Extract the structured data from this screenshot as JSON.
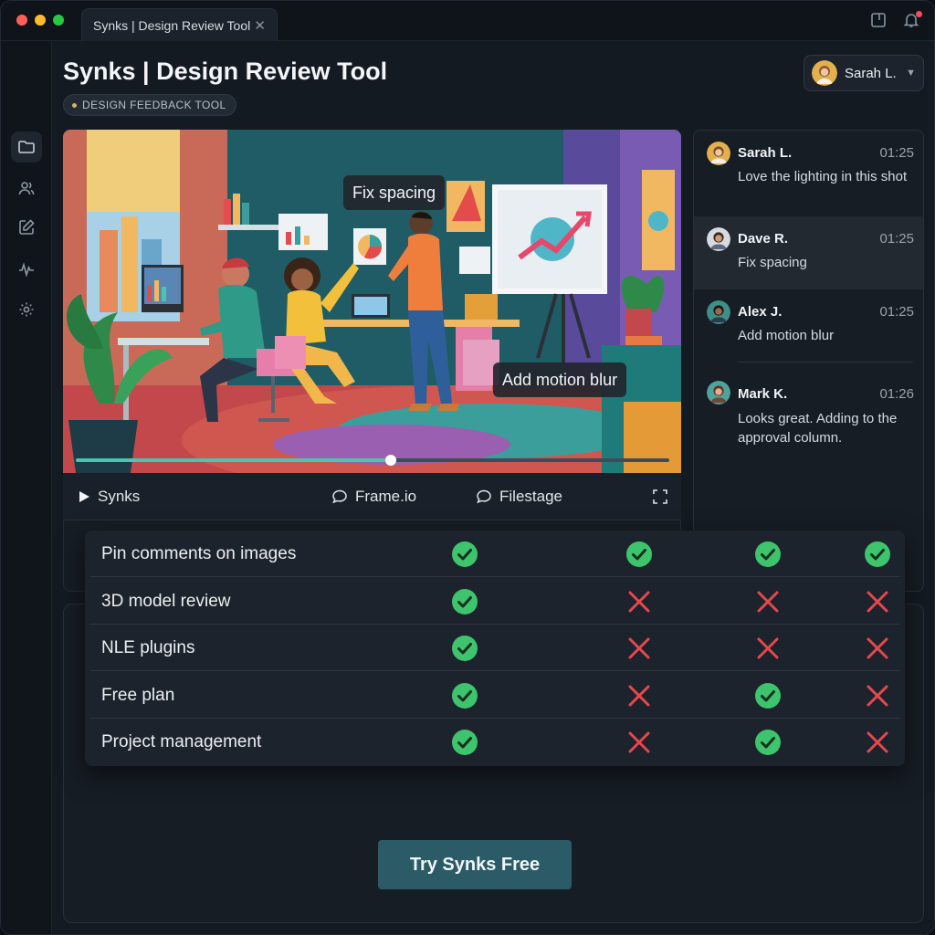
{
  "window": {
    "tab_title": "Synks | Design Review Tool",
    "icons": [
      "close-dot",
      "minimize-dot",
      "maximize-dot",
      "tab-close-icon",
      "bookmark-icon",
      "bell-icon"
    ],
    "traffic_colors": [
      "#ff5f57",
      "#febc2e",
      "#28c840"
    ]
  },
  "sidebar": {
    "items": [
      {
        "name": "folder-icon"
      },
      {
        "name": "users-icon"
      },
      {
        "name": "edit-icon"
      },
      {
        "name": "activity-icon"
      },
      {
        "name": "settings-icon"
      }
    ]
  },
  "header": {
    "title": "Synks | Design Review Tool",
    "badge": "DESIGN FEEDBACK TOOL",
    "user": {
      "name": "Sarah L."
    }
  },
  "video": {
    "annotations": [
      "Fix spacing",
      "Add motion blur"
    ],
    "progress": 0.53,
    "controls": {
      "play_label": "Synks",
      "frameio_label": "Frame.io",
      "filestage_label": "Filestage"
    }
  },
  "comments": [
    {
      "name": "Sarah L.",
      "time": "01:25",
      "text": "Love the lighting in this shot",
      "avatar_color": "#d9a063"
    },
    {
      "name": "Dave R.",
      "time": "01:25",
      "text": "Fix spacing",
      "avatar_color": "#b98b62"
    },
    {
      "name": "Alex J.",
      "time": "01:25",
      "text": "Add motion blur",
      "avatar_color": "#7d5a44"
    },
    {
      "name": "Mark K.",
      "time": "01:26",
      "text": "Looks great. Adding to the approval column.",
      "avatar_color": "#c58a6a"
    }
  ],
  "comparison": {
    "rows": [
      {
        "feature": "Pin comments on images",
        "values": [
          true,
          true,
          true,
          true
        ]
      },
      {
        "feature": "3D model review",
        "values": [
          true,
          false,
          false,
          false
        ]
      },
      {
        "feature": "NLE plugins",
        "values": [
          true,
          false,
          false,
          false
        ]
      },
      {
        "feature": "Free plan",
        "values": [
          true,
          false,
          true,
          false
        ]
      },
      {
        "feature": "Project management",
        "values": [
          true,
          false,
          true,
          false
        ]
      }
    ],
    "check_color": "#3ec46d",
    "cross_color": "#e5484d"
  },
  "cta": {
    "label": "Try Synks Free"
  }
}
